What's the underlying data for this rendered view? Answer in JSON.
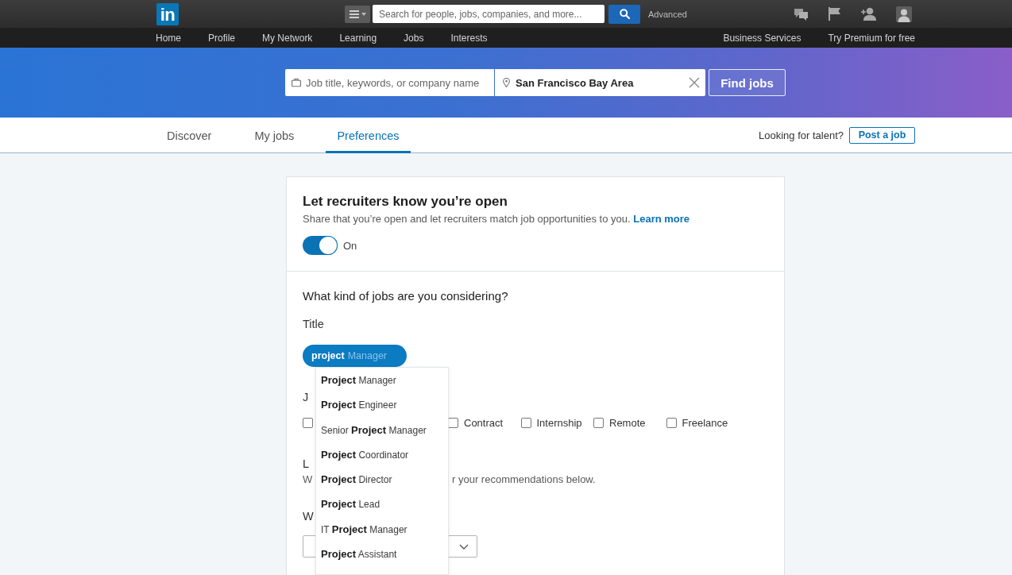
{
  "global_nav": {
    "logo": "in",
    "search": {
      "placeholder": "Search for people, jobs, companies, and more..."
    },
    "advanced_link": "Advanced",
    "links": [
      "Home",
      "Profile",
      "My Network",
      "Learning",
      "Jobs",
      "Interests"
    ],
    "right_links": [
      "Business Services",
      "Try Premium for free"
    ]
  },
  "job_search": {
    "keywords": {
      "placeholder": "Job title, keywords, or company name"
    },
    "location": {
      "value": "San Francisco Bay Area"
    },
    "button": "Find jobs"
  },
  "tabs": [
    {
      "label": "Discover",
      "selected": false
    },
    {
      "label": "My jobs",
      "selected": false
    },
    {
      "label": "Preferences",
      "selected": true
    }
  ],
  "talent": {
    "prompt": "Looking for talent?",
    "button": "Post a job"
  },
  "open_section": {
    "title": "Let recruiters know you’re open",
    "description": "Share that you’re open and let recruiters match job opportunities to you.",
    "link": "Learn more",
    "toggle": {
      "on": true,
      "label": "On"
    }
  },
  "jobs_section": {
    "title": "What kind of jobs are you considering?",
    "title_field": {
      "label": "Title",
      "value": "project",
      "autocomplete": "Manager",
      "suggestions": [
        "**Project** Manager",
        "**Project** Engineer",
        "Senior **Project** Manager",
        "**Project** Coordinator",
        "**Project** Director",
        "**Project** Lead",
        "IT **Project** Manager",
        "**Project** Assistant"
      ]
    },
    "job_type": {
      "label": "J",
      "options": [
        {
          "checked": false
        },
        {
          "label": "Contract",
          "checked": false
        },
        {
          "label": "Internship",
          "checked": false
        },
        {
          "label": "Remote",
          "checked": false
        },
        {
          "label": "Freelance",
          "checked": false
        }
      ]
    },
    "location": {
      "label": "L",
      "note": {
        "start": "W",
        "end": "r your recommendations below."
      }
    },
    "start": {
      "label": "W"
    }
  }
}
